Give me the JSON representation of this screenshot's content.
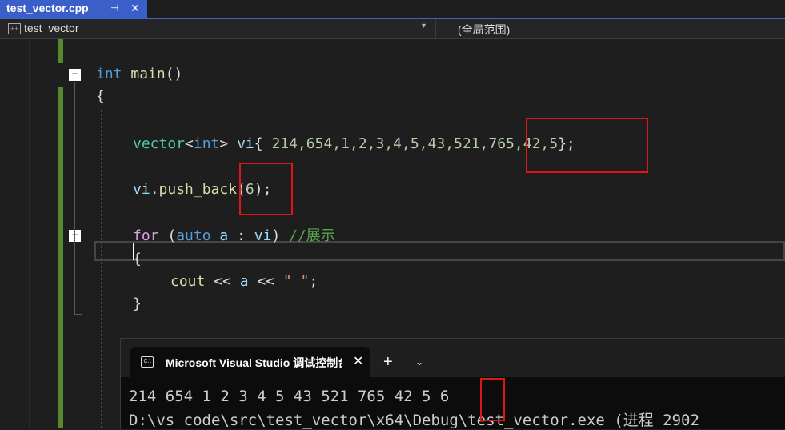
{
  "tab": {
    "title": "test_vector.cpp",
    "pin": "⊣",
    "close": "✕"
  },
  "navbar": {
    "scope": "test_vector",
    "scope_icon": "++",
    "dropdown_glyph": "▾",
    "member": "(全局范围)"
  },
  "code": {
    "line1": {
      "kw": "int",
      "fn": "main",
      "rest": "()"
    },
    "line2": "{",
    "line3": {
      "ty": "vector",
      "lt": "<",
      "kw": "int",
      "gt": ">",
      "var": "vi",
      "open": "{ ",
      "nums": "214,654,1,2,3,4,5,43,521,765,42,5",
      "close": "};"
    },
    "line4": {
      "var": "vi",
      "dot": ".",
      "fn": "push_back",
      "open": "(",
      "num": "6",
      "close": ");"
    },
    "line5": {
      "kw": "for",
      "p1": " (",
      "kw2": "auto",
      "sp": " ",
      "var": "a",
      "mid": " : ",
      "var2": "vi",
      "p2": ")",
      "comment": " //展示"
    },
    "line6": "{",
    "line7": {
      "fn": "cout",
      "op1": " << ",
      "var": "a",
      "op2": " << ",
      "str": "\" \"",
      "semi": ";"
    },
    "line8": "}"
  },
  "console": {
    "tab_icon": "C:\\",
    "tab_title": "Microsoft Visual Studio 调试控制台",
    "close": "✕",
    "add": "+",
    "dropdown": "⌄",
    "output1": "214 654 1 2 3 4 5 43 521 765 42 5 6",
    "output2": "D:\\vs code\\src\\test_vector\\x64\\Debug\\test_vector.exe (进程 2902"
  },
  "fold_glyph": "−"
}
